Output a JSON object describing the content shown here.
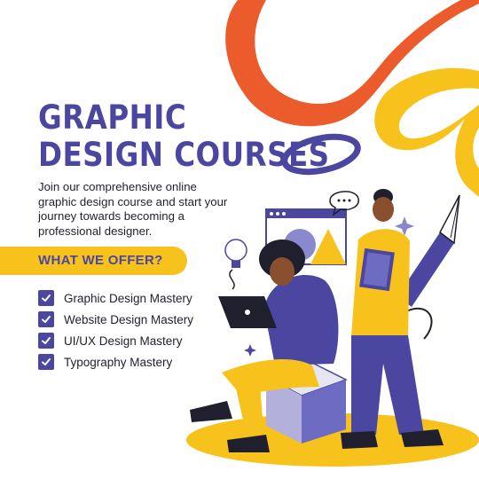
{
  "headline": {
    "line1": "GRAPHIC",
    "line2": "DESIGN COURSES"
  },
  "intro": "Join our comprehensive online graphic design course and start your journey towards becoming a professional designer.",
  "offer": {
    "label": "WHAT WE OFFER?"
  },
  "features": [
    {
      "label": "Graphic Design Mastery"
    },
    {
      "label": "Website Design Mastery"
    },
    {
      "label": "UI/UX Design Mastery"
    },
    {
      "label": "Typography Mastery"
    }
  ],
  "icons": {
    "feature_check": "checkbox-checked-icon"
  },
  "colors": {
    "brand_indigo": "#4b47a1",
    "accent_yellow": "#f7c21b",
    "accent_orange": "#eb5b2c",
    "text_dark": "#1f1f2e",
    "background": "#ffffff"
  }
}
